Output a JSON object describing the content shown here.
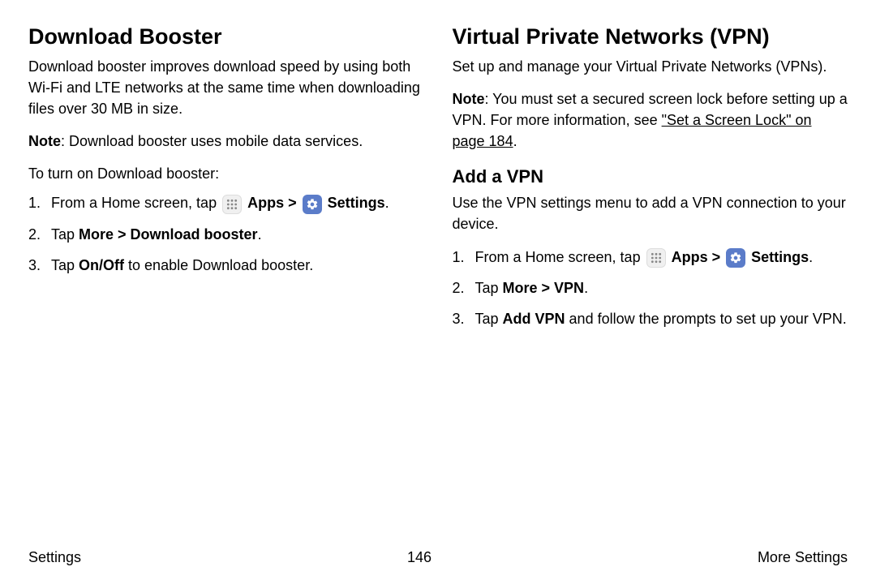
{
  "left": {
    "heading": "Download Booster",
    "intro": "Download booster improves download speed by using both Wi-Fi and LTE networks at the same time when downloading files over 30 MB in size.",
    "note_label": "Note",
    "note_text": ": Download booster uses mobile data services.",
    "lead": "To turn on Download booster:",
    "step1_prefix": "From a Home screen, tap ",
    "step1_apps": "Apps",
    "step1_sep": " > ",
    "step1_settings": "Settings",
    "step1_suffix": ".",
    "step2_prefix": "Tap ",
    "step2_bold": "More > Download booster",
    "step2_suffix": ".",
    "step3_prefix": "Tap ",
    "step3_bold": "On/Off",
    "step3_suffix": " to enable Download booster."
  },
  "right": {
    "heading": "Virtual Private Networks (VPN)",
    "intro": "Set up and manage your Virtual Private Networks (VPNs).",
    "note_label": "Note",
    "note_text": ": You must set a secured screen lock before setting up a VPN. For more information, see ",
    "note_link": "\"Set a Screen Lock\" on page 184",
    "note_suffix": ".",
    "subheading": "Add a VPN",
    "subintro": "Use the VPN settings menu to add a VPN connection to your device.",
    "step1_prefix": "From a Home screen, tap ",
    "step1_apps": "Apps",
    "step1_sep": " > ",
    "step1_settings": "Settings",
    "step1_suffix": ".",
    "step2_prefix": "Tap ",
    "step2_bold": "More > VPN",
    "step2_suffix": ".",
    "step3_prefix": "Tap ",
    "step3_bold": "Add VPN",
    "step3_suffix": " and follow the prompts to set up your VPN."
  },
  "footer": {
    "left": "Settings",
    "center": "146",
    "right": "More Settings"
  }
}
